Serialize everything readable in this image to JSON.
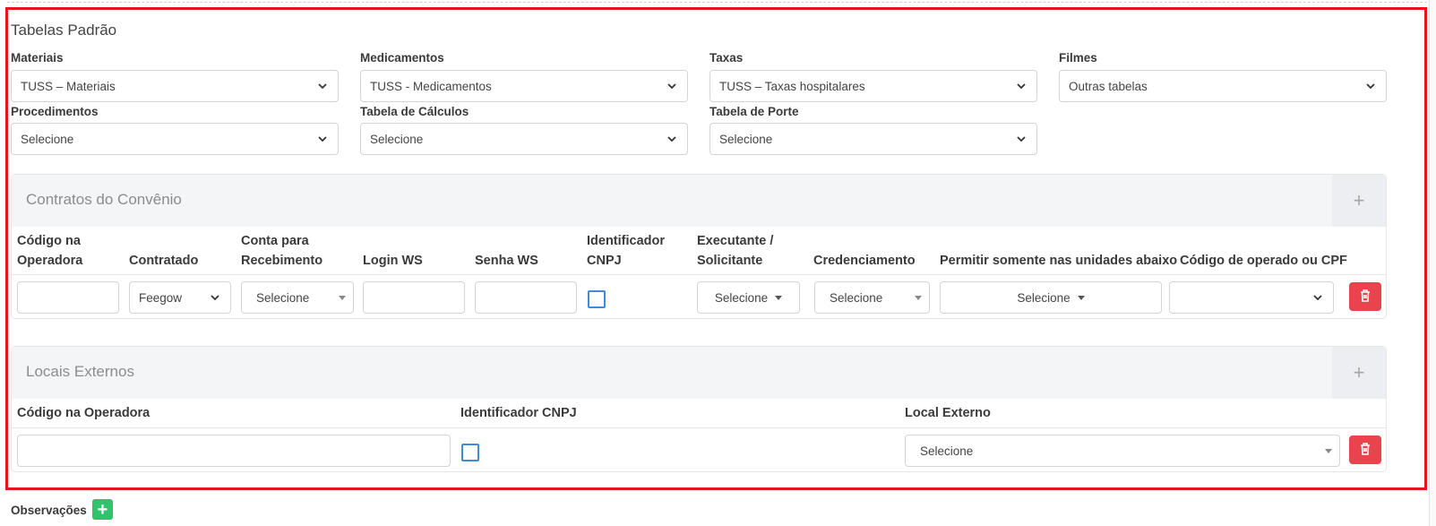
{
  "tabelas": {
    "title": "Tabelas Padrão",
    "fields": [
      {
        "label": "Materiais",
        "value": "TUSS – Materiais"
      },
      {
        "label": "Medicamentos",
        "value": "TUSS - Medicamentos"
      },
      {
        "label": "Taxas",
        "value": "TUSS – Taxas hospitalares"
      },
      {
        "label": "Filmes",
        "value": "Outras tabelas"
      },
      {
        "label": "Procedimentos",
        "value": "Selecione"
      },
      {
        "label": "Tabela de Cálculos",
        "value": "Selecione"
      },
      {
        "label": "Tabela de Porte",
        "value": "Selecione"
      }
    ]
  },
  "contratos": {
    "title": "Contratos do Convênio",
    "add": "+",
    "headers": [
      "Código na\nOperadora",
      "Contratado",
      "Conta para\nRecebimento",
      "Login WS",
      "Senha WS",
      "Identificador\nCNPJ",
      "Executante /\nSolicitante",
      "Credenciamento",
      "Permitir somente nas unidades abaixo",
      "Código de operado ou CPF"
    ],
    "row": {
      "contratado": "Feegow",
      "conta": "Selecione",
      "executante": "Selecione",
      "credenciamento": "Selecione",
      "unidades": "Selecione",
      "codigo_cpf": ""
    }
  },
  "locais": {
    "title": "Locais Externos",
    "add": "+",
    "headers": [
      "Código na Operadora",
      "Identificador CNPJ",
      "Local Externo"
    ],
    "row": {
      "local_externo": "Selecione"
    }
  },
  "observacoes": {
    "label": "Observações",
    "add": "+"
  },
  "colors": {
    "highlight": "#e8131b",
    "danger": "#e9434d",
    "success": "#2fc46b",
    "checkbox": "#3f8bd6"
  },
  "icons": [
    "chevron-down-icon",
    "caret-down-icon",
    "trash-icon",
    "plus-icon"
  ]
}
